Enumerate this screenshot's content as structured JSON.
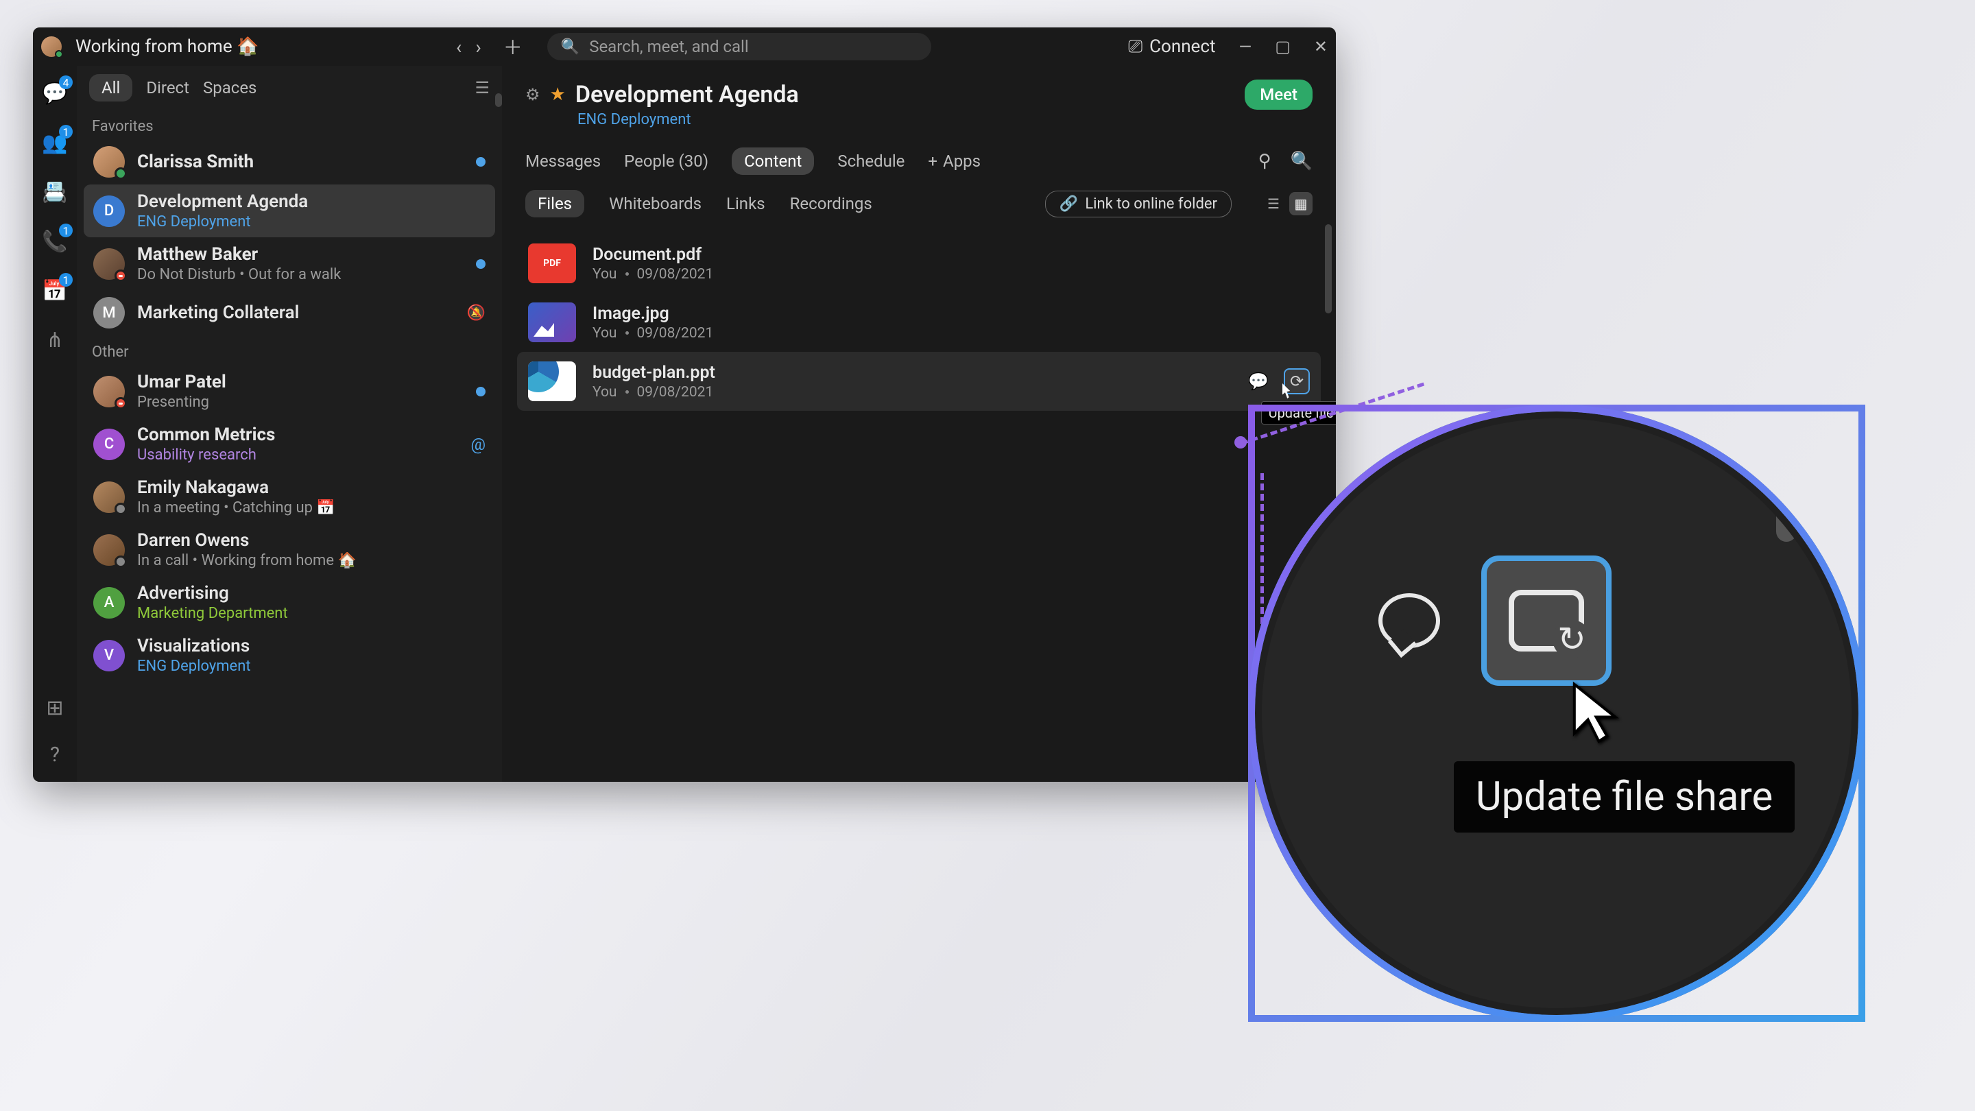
{
  "titlebar": {
    "status_text": "Working from home 🏠",
    "search_placeholder": "Search, meet, and call",
    "connect_label": "Connect"
  },
  "sidebar": {
    "tabs": {
      "all": "All",
      "direct": "Direct",
      "spaces": "Spaces"
    },
    "sections": {
      "favorites": "Favorites",
      "other": "Other"
    },
    "items": [
      {
        "name": "Clarissa Smith",
        "sub": "",
        "unread": true,
        "avatar_letter": ""
      },
      {
        "name": "Development Agenda",
        "sub": "ENG Deployment",
        "sub_class": "blue",
        "selected": true,
        "avatar_letter": "D"
      },
      {
        "name": "Matthew Baker",
        "sub": "Do Not Disturb  •  Out for a walk",
        "unread": true,
        "avatar_letter": ""
      },
      {
        "name": "Marketing Collateral",
        "sub": "",
        "muted": true,
        "avatar_letter": "M"
      },
      {
        "name": "Umar Patel",
        "sub": "Presenting",
        "unread": true,
        "avatar_letter": ""
      },
      {
        "name": "Common Metrics",
        "sub": "Usability research",
        "sub_class": "purple",
        "mention": true,
        "avatar_letter": "C"
      },
      {
        "name": "Emily Nakagawa",
        "sub": "In a meeting  •  Catching up 📅",
        "avatar_letter": ""
      },
      {
        "name": "Darren Owens",
        "sub": "In a call  •  Working from home 🏠",
        "avatar_letter": ""
      },
      {
        "name": "Advertising",
        "sub": "Marketing Department",
        "sub_class": "green",
        "avatar_letter": "A"
      },
      {
        "name": "Visualizations",
        "sub": "ENG Deployment",
        "sub_class": "blue",
        "avatar_letter": "V"
      }
    ]
  },
  "rail": {
    "badges": {
      "chats": "4",
      "teams": "1",
      "calls": "1",
      "calendar": "1"
    }
  },
  "content": {
    "title": "Development Agenda",
    "parent": "ENG Deployment",
    "meet_label": "Meet",
    "tabs": {
      "messages": "Messages",
      "people": "People (30)",
      "content": "Content",
      "schedule": "Schedule",
      "apps": "Apps"
    },
    "file_tabs": {
      "files": "Files",
      "whiteboards": "Whiteboards",
      "links": "Links",
      "recordings": "Recordings"
    },
    "link_folder": "Link to online folder",
    "files": [
      {
        "name": "Document.pdf",
        "owner": "You",
        "date": "09/08/2021"
      },
      {
        "name": "Image.jpg",
        "owner": "You",
        "date": "09/08/2021"
      },
      {
        "name": "budget-plan.ppt",
        "owner": "You",
        "date": "09/08/2021"
      }
    ],
    "tooltip": "Update file share"
  },
  "zoom": {
    "tooltip": "Update file share"
  }
}
